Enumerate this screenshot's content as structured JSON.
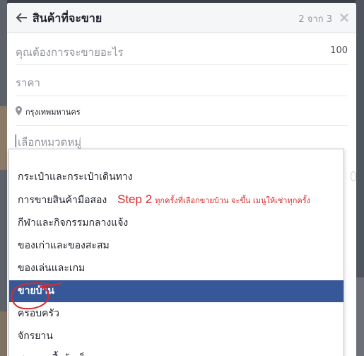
{
  "dialog": {
    "title": "สินค้าที่จะขาย",
    "step": "2 จาก 3"
  },
  "form": {
    "what_placeholder": "คุณต้องการจะขายอะไร",
    "what_counter": "100",
    "price_placeholder": "ราคา",
    "location": "กรุงเทพมหานคร",
    "category_placeholder": "เลือกหมวดหมู่"
  },
  "dropdown": {
    "options": [
      "กระเป๋าและกระเป๋าเดินทาง",
      "การขายสินค้ามือสอง",
      "กีฬาและกิจกรรมกลางแจ้ง",
      "ของเก่าและของสะสม",
      "ของเล่นและเกม",
      "ขายบ้าน",
      "ครอบครัว",
      "จักรยาน",
      "ชุดและเสื้อผ้าเด็ก"
    ],
    "selected": "ขายบ้าน"
  },
  "annotation": {
    "step_label": "Step 2",
    "note": "ทุกครั้งที่เลือกขายบ้าน จะขึ้น เมนูให้เช่าทุกครั้ง",
    "color": "#d92b2b"
  },
  "icons": [
    "back-arrow-icon",
    "close-icon",
    "location-pin-icon"
  ]
}
